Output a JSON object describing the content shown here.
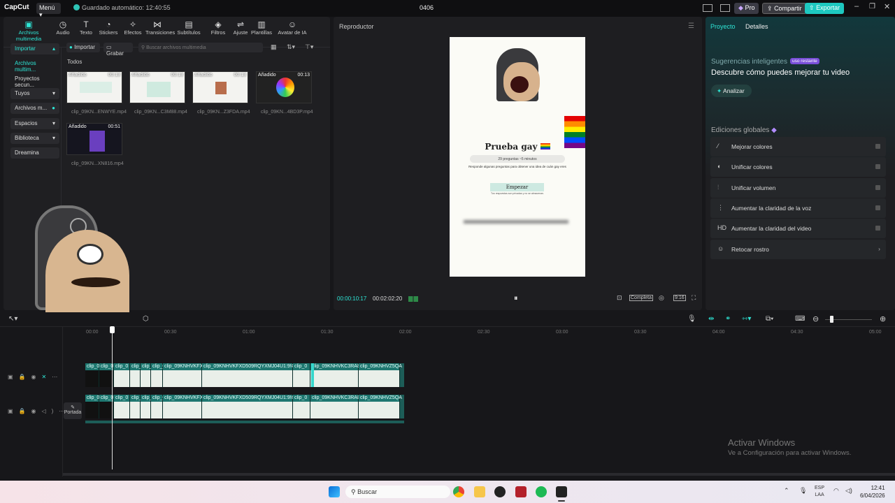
{
  "titlebar": {
    "logo": "CapCut",
    "menu": "Menú",
    "autosave": "Guardado automático: 12:40:55",
    "project_name": "0406",
    "pro": "Pro",
    "share": "Compartir",
    "export": "Exportar"
  },
  "toolbar": [
    {
      "label": "Archivos multimedia",
      "icon": "media-icon"
    },
    {
      "label": "Audio",
      "icon": "audio-icon"
    },
    {
      "label": "Texto",
      "icon": "text-icon"
    },
    {
      "label": "Stickers",
      "icon": "sticker-icon"
    },
    {
      "label": "Efectos",
      "icon": "effects-icon"
    },
    {
      "label": "Transiciones",
      "icon": "transition-icon"
    },
    {
      "label": "Subtítulos",
      "icon": "subtitle-icon"
    },
    {
      "label": "Filtros",
      "icon": "filter-icon"
    },
    {
      "label": "Ajuste",
      "icon": "adjust-icon"
    },
    {
      "label": "Plantillas",
      "icon": "template-icon"
    },
    {
      "label": "Avatar de IA",
      "icon": "avatar-icon"
    }
  ],
  "sidebar": {
    "items": [
      {
        "label": "Importar"
      },
      {
        "label": "Archivos multim..."
      },
      {
        "label": "Proyectos secun..."
      },
      {
        "label": "Tuyos"
      },
      {
        "label": "Archivos m..."
      },
      {
        "label": "Espacios"
      },
      {
        "label": "Biblioteca"
      },
      {
        "label": "Dreamina"
      }
    ]
  },
  "media": {
    "import_btn": "Importar",
    "record_btn": "Grabar",
    "search_placeholder": "Buscar archivos multimedia",
    "section": "Todos",
    "items": [
      {
        "tag": "Añadido",
        "duration": "00:13",
        "name": "clip_09KN...ENWYE.mp4"
      },
      {
        "tag": "Añadido",
        "duration": "00:13",
        "name": "clip_09KN...C3M88.mp4"
      },
      {
        "tag": "Añadido",
        "duration": "00:13",
        "name": "clip_09KN...Z3FDA.mp4"
      },
      {
        "tag": "Añadido",
        "duration": "00:13",
        "name": "clip_09KN...4BD3P.mp4"
      },
      {
        "tag": "Añadido",
        "duration": "00:51",
        "name": "clip_09KN...XN816.mp4"
      }
    ]
  },
  "player": {
    "title": "Reproductor",
    "current_time": "00:00:10:17",
    "total_time": "00:02:02:20",
    "complete_label": "Completa",
    "ratio_label": "9:16",
    "video": {
      "heading": "Prueba gay",
      "meta": "29 preguntas  ~5 minutos",
      "desc": "Responde algunas preguntas para obtener una idea de cuán gay eres",
      "start_btn": "Empezar",
      "note": "Tus respuestas son privadas y no se almacenan."
    }
  },
  "right": {
    "tab_project": "Proyecto",
    "tab_details": "Detalles",
    "suggest_title": "Sugerencias inteligentes",
    "suggest_badge": "uso restante",
    "suggest_desc": "Descubre cómo puedes mejorar tu video",
    "analyze_btn": "Analizar",
    "global_title": "Ediciones globales",
    "global_items": [
      {
        "label": "Mejorar colores",
        "icon": "wand-icon"
      },
      {
        "label": "Unificar colores",
        "icon": "palette-icon"
      },
      {
        "label": "Unificar volumen",
        "icon": "sliders-icon"
      },
      {
        "label": "Aumentar la claridad de la voz",
        "icon": "voice-icon"
      },
      {
        "label": "Aumentar la claridad del video",
        "icon": "hd-icon"
      },
      {
        "label": "Retocar rostro",
        "icon": "face-icon"
      }
    ]
  },
  "timeline": {
    "ruler": [
      "00:00",
      "00:30",
      "01:00",
      "01:30",
      "02:00",
      "02:30",
      "03:00",
      "03:30",
      "04:00",
      "04:30",
      "05:00"
    ],
    "cover_label": "Portada",
    "clips": [
      "clip_0",
      "clip_0",
      "clip_0",
      "clip_0",
      "clip_0",
      "clip_0",
      "clip_09KNHVKFXD",
      "clip_09KNHVKFXD509RQYXMJ04U1:9!#",
      "clip_0",
      "clip_09KNHVKC3RA8V",
      "clip_09KNHVZ5QA"
    ]
  },
  "watermark": {
    "line1": "Activar Windows",
    "line2": "Ve a Configuración para activar Windows."
  },
  "taskbar": {
    "search": "Buscar",
    "lang1": "ESP",
    "lang2": "LAA",
    "time": "12:41",
    "date": "6/04/2026"
  }
}
